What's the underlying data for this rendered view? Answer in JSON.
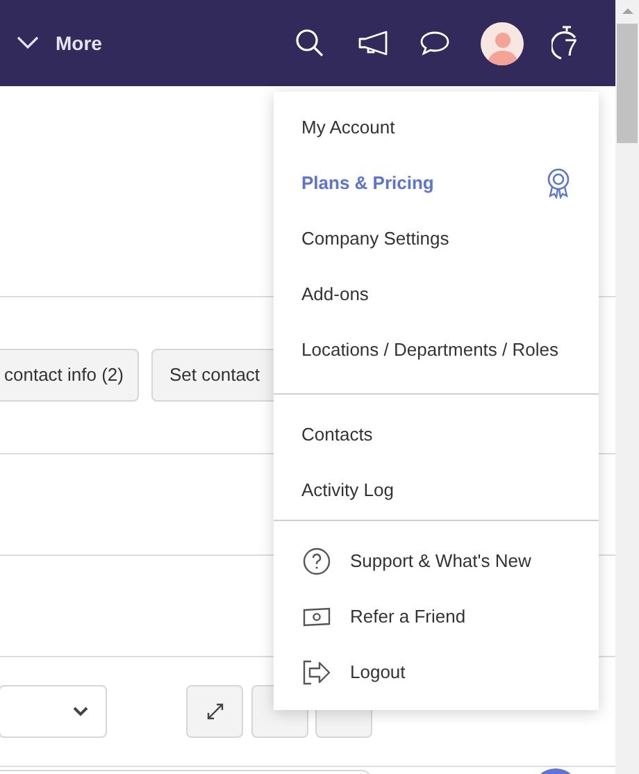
{
  "header": {
    "more_label": "More",
    "logo_text": "7"
  },
  "content": {
    "buttons": [
      "contact info (2)",
      "Set contact"
    ]
  },
  "menu": {
    "sections": [
      {
        "items": [
          {
            "label": "My Account",
            "highlighted": false
          },
          {
            "label": "Plans & Pricing",
            "highlighted": true
          },
          {
            "label": "Company Settings",
            "highlighted": false
          },
          {
            "label": "Add-ons",
            "highlighted": false
          },
          {
            "label": "Locations / Departments / Roles",
            "highlighted": false
          }
        ]
      },
      {
        "items": [
          {
            "label": "Contacts",
            "highlighted": false
          },
          {
            "label": "Activity Log",
            "highlighted": false
          }
        ]
      },
      {
        "items": [
          {
            "label": "Support & What's New",
            "highlighted": false
          },
          {
            "label": "Refer a Friend",
            "highlighted": false
          },
          {
            "label": "Logout",
            "highlighted": false
          }
        ]
      }
    ]
  }
}
